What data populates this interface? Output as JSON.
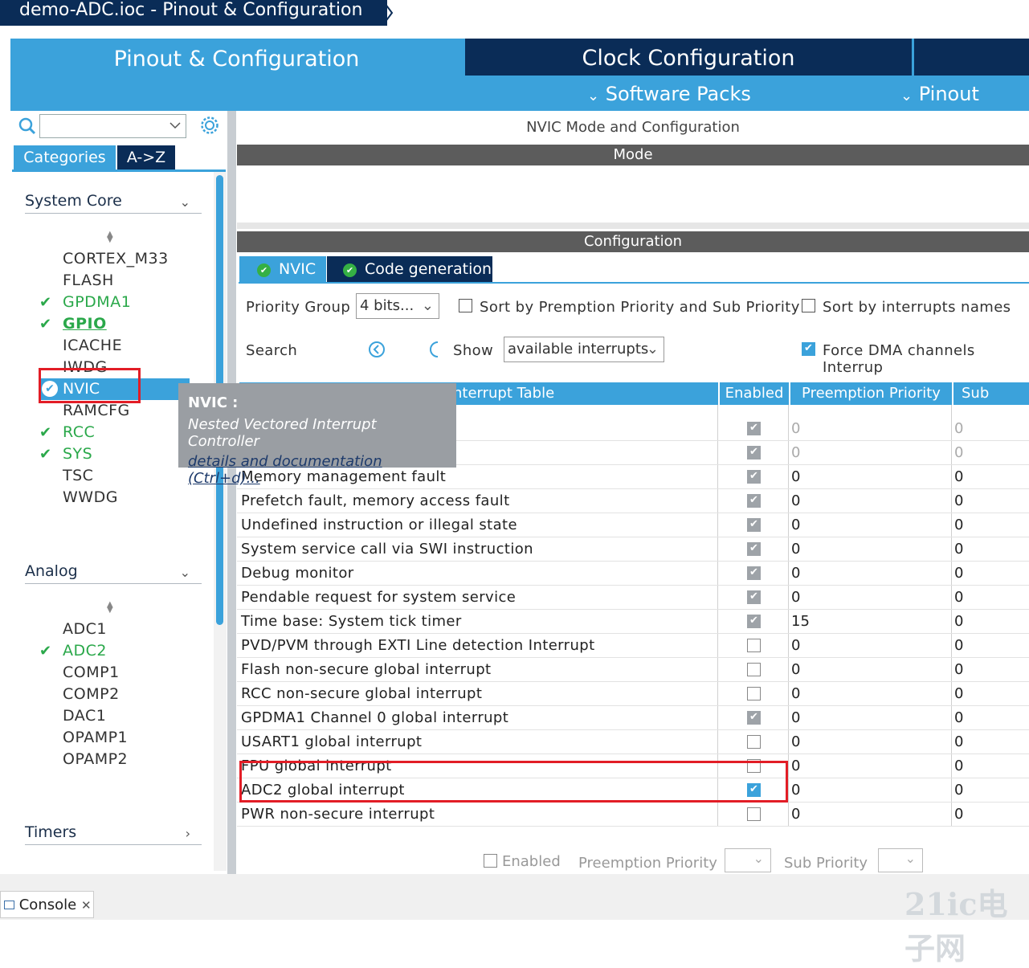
{
  "window": {
    "title": "demo-ADC.ioc - Pinout & Configuration"
  },
  "nav": {
    "pinout_tab": "Pinout & Configuration",
    "clock_tab": "Clock Configuration",
    "software_packs": "Software Packs",
    "pinout_menu": "Pinout"
  },
  "sidebar": {
    "tabs": [
      "Categories",
      "A->Z"
    ],
    "sections": {
      "system_core": "System Core",
      "analog": "Analog",
      "timers": "Timers"
    },
    "system_core_items": [
      "CORTEX_M33",
      "FLASH",
      "GPDMA1",
      "GPIO",
      "ICACHE",
      "IWDG",
      "NVIC",
      "RAMCFG",
      "RCC",
      "SYS",
      "TSC",
      "WWDG"
    ],
    "analog_items": [
      "ADC1",
      "ADC2",
      "COMP1",
      "COMP2",
      "DAC1",
      "OPAMP1",
      "OPAMP2"
    ]
  },
  "tooltip": {
    "title": "NVIC :",
    "description": "Nested Vectored Interrupt Controller",
    "link": "details and documentation (Ctrl+d)..."
  },
  "panel": {
    "title": "NVIC Mode and Configuration",
    "mode_bar": "Mode",
    "config_bar": "Configuration",
    "tabs": [
      "NVIC",
      "Code generation"
    ]
  },
  "controls": {
    "priority_group_label": "Priority Group",
    "priority_group_value": "4 bits...",
    "sort_premption": "Sort by Premption Priority and Sub Priority",
    "sort_names": "Sort by interrupts names",
    "search_label": "Search",
    "show_label": "Show",
    "show_value": "available interrupts",
    "force_dma": "Force DMA channels Interrup"
  },
  "table": {
    "headers": [
      "nterrupt Table",
      "Enabled",
      "Preemption Priority",
      "Sub Priori"
    ],
    "rows": [
      {
        "name": "",
        "enabled": "grey",
        "pre": "0",
        "sub": "0",
        "dim": true
      },
      {
        "name": "",
        "enabled": "grey",
        "pre": "0",
        "sub": "0",
        "dim": true
      },
      {
        "name": "Memory management fault",
        "enabled": "grey",
        "pre": "0",
        "sub": "0"
      },
      {
        "name": "Prefetch fault, memory access fault",
        "enabled": "grey",
        "pre": "0",
        "sub": "0"
      },
      {
        "name": "Undefined instruction or illegal state",
        "enabled": "grey",
        "pre": "0",
        "sub": "0"
      },
      {
        "name": "System service call via SWI instruction",
        "enabled": "grey",
        "pre": "0",
        "sub": "0"
      },
      {
        "name": "Debug monitor",
        "enabled": "grey",
        "pre": "0",
        "sub": "0"
      },
      {
        "name": "Pendable request for system service",
        "enabled": "grey",
        "pre": "0",
        "sub": "0"
      },
      {
        "name": "Time base: System tick timer",
        "enabled": "grey",
        "pre": "15",
        "sub": "0"
      },
      {
        "name": "PVD/PVM through EXTI Line detection Interrupt",
        "enabled": "off",
        "pre": "0",
        "sub": "0"
      },
      {
        "name": "Flash non-secure global interrupt",
        "enabled": "off",
        "pre": "0",
        "sub": "0"
      },
      {
        "name": "RCC non-secure global interrupt",
        "enabled": "off",
        "pre": "0",
        "sub": "0"
      },
      {
        "name": "GPDMA1 Channel 0 global interrupt",
        "enabled": "grey",
        "pre": "0",
        "sub": "0"
      },
      {
        "name": "USART1 global interrupt",
        "enabled": "off",
        "pre": "0",
        "sub": "0"
      },
      {
        "name": "FPU global interrupt",
        "enabled": "off",
        "pre": "0",
        "sub": "0"
      },
      {
        "name": "ADC2 global interrupt",
        "enabled": "on",
        "pre": "0",
        "sub": "0"
      },
      {
        "name": "PWR non-secure interrupt",
        "enabled": "off",
        "pre": "0",
        "sub": "0"
      }
    ]
  },
  "footer": {
    "enabled": "Enabled",
    "preemption": "Preemption Priority",
    "sub": "Sub Priority"
  },
  "console": {
    "label": "Console"
  },
  "watermark": "21ic电子网",
  "colors": {
    "accent": "#3ba2db",
    "dark": "#0a2c57",
    "check_green": "#2aa84a",
    "highlight_red": "#e21d26"
  }
}
